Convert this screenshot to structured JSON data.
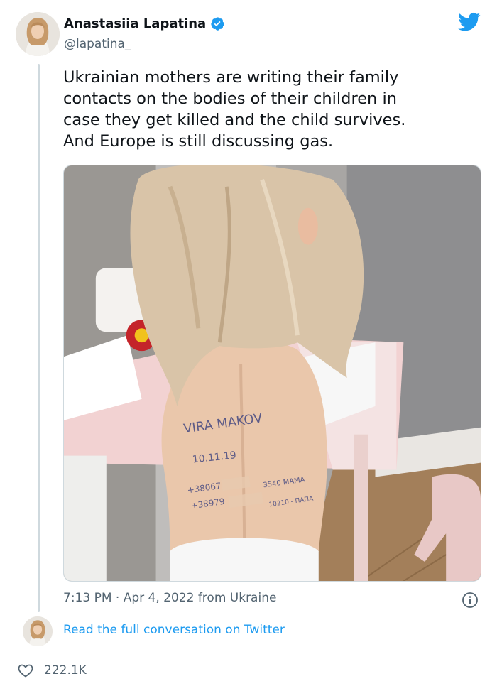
{
  "author": {
    "display_name": "Anastasiia Lapatina",
    "handle": "@lapatina_",
    "verified": true
  },
  "tweet": {
    "text": "Ukrainian mothers are writing their family\ncontacts on the bodies of their children in\ncase they get killed and the child survives.\nAnd Europe is still discussing gas.",
    "meta": "7:13 PM · Apr 4, 2022 from Ukraine"
  },
  "photo": {
    "handwriting": {
      "name": "VIRA MAKOV",
      "date": "10.11.19",
      "line3a": "+38067",
      "line3b": "3540 МАМА",
      "line4a": "+38979",
      "line4b": "10210 - ПАПА"
    }
  },
  "footer": {
    "read_link": "Read the full conversation on Twitter",
    "like_count": "222.1K"
  },
  "colors": {
    "link": "#1d9bf0",
    "secondary_text": "#536471",
    "verified": "#1d9bf0",
    "divider": "#cfd9de"
  },
  "icons": [
    "twitter-bird-icon",
    "verified-badge-icon",
    "info-icon",
    "heart-icon"
  ]
}
